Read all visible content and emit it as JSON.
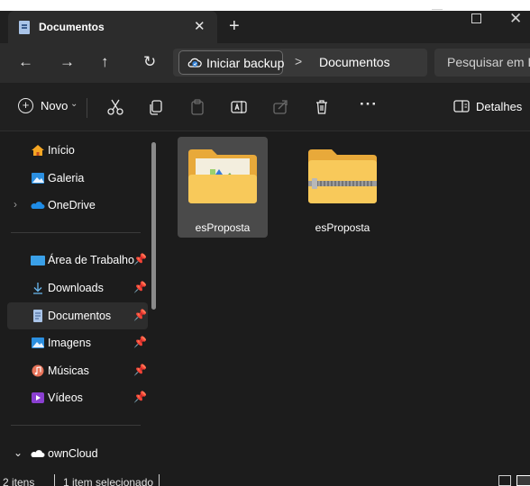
{
  "window": {
    "tab_title": "Documentos",
    "tab_close_icon": "close-icon",
    "new_tab_icon": "plus-icon"
  },
  "address": {
    "backup_label": "Iniciar backup",
    "separator": ">",
    "crumb": "Documentos",
    "search_placeholder": "Pesquisar em D"
  },
  "toolbar": {
    "new_label": "Novo",
    "more_label": "···",
    "details_label": "Detalhes"
  },
  "sidebar": {
    "items": [
      {
        "label": "Início",
        "icon": "home-icon"
      },
      {
        "label": "Galeria",
        "icon": "gallery-icon"
      },
      {
        "label": "OneDrive",
        "icon": "onedrive-icon"
      },
      {
        "label": "Área de Trabalho",
        "icon": "desktop-icon"
      },
      {
        "label": "Downloads",
        "icon": "download-icon"
      },
      {
        "label": "Documentos",
        "icon": "documents-icon"
      },
      {
        "label": "Imagens",
        "icon": "pictures-icon"
      },
      {
        "label": "Músicas",
        "icon": "music-icon"
      },
      {
        "label": "Vídeos",
        "icon": "videos-icon"
      },
      {
        "label": "ownCloud",
        "icon": "owncloud-icon"
      }
    ]
  },
  "files": [
    {
      "name": "esProposta",
      "type": "folder",
      "selected": true
    },
    {
      "name": "esProposta",
      "type": "zip-folder",
      "selected": false
    }
  ],
  "status": {
    "count": "2 itens",
    "selected": "1 item selecionado"
  },
  "colors": {
    "background": "#1c1c1c",
    "titlebar": "#202020",
    "addressbar": "#2c2c2c",
    "selection": "#4a4a4a",
    "folder": "#f8c95a"
  }
}
